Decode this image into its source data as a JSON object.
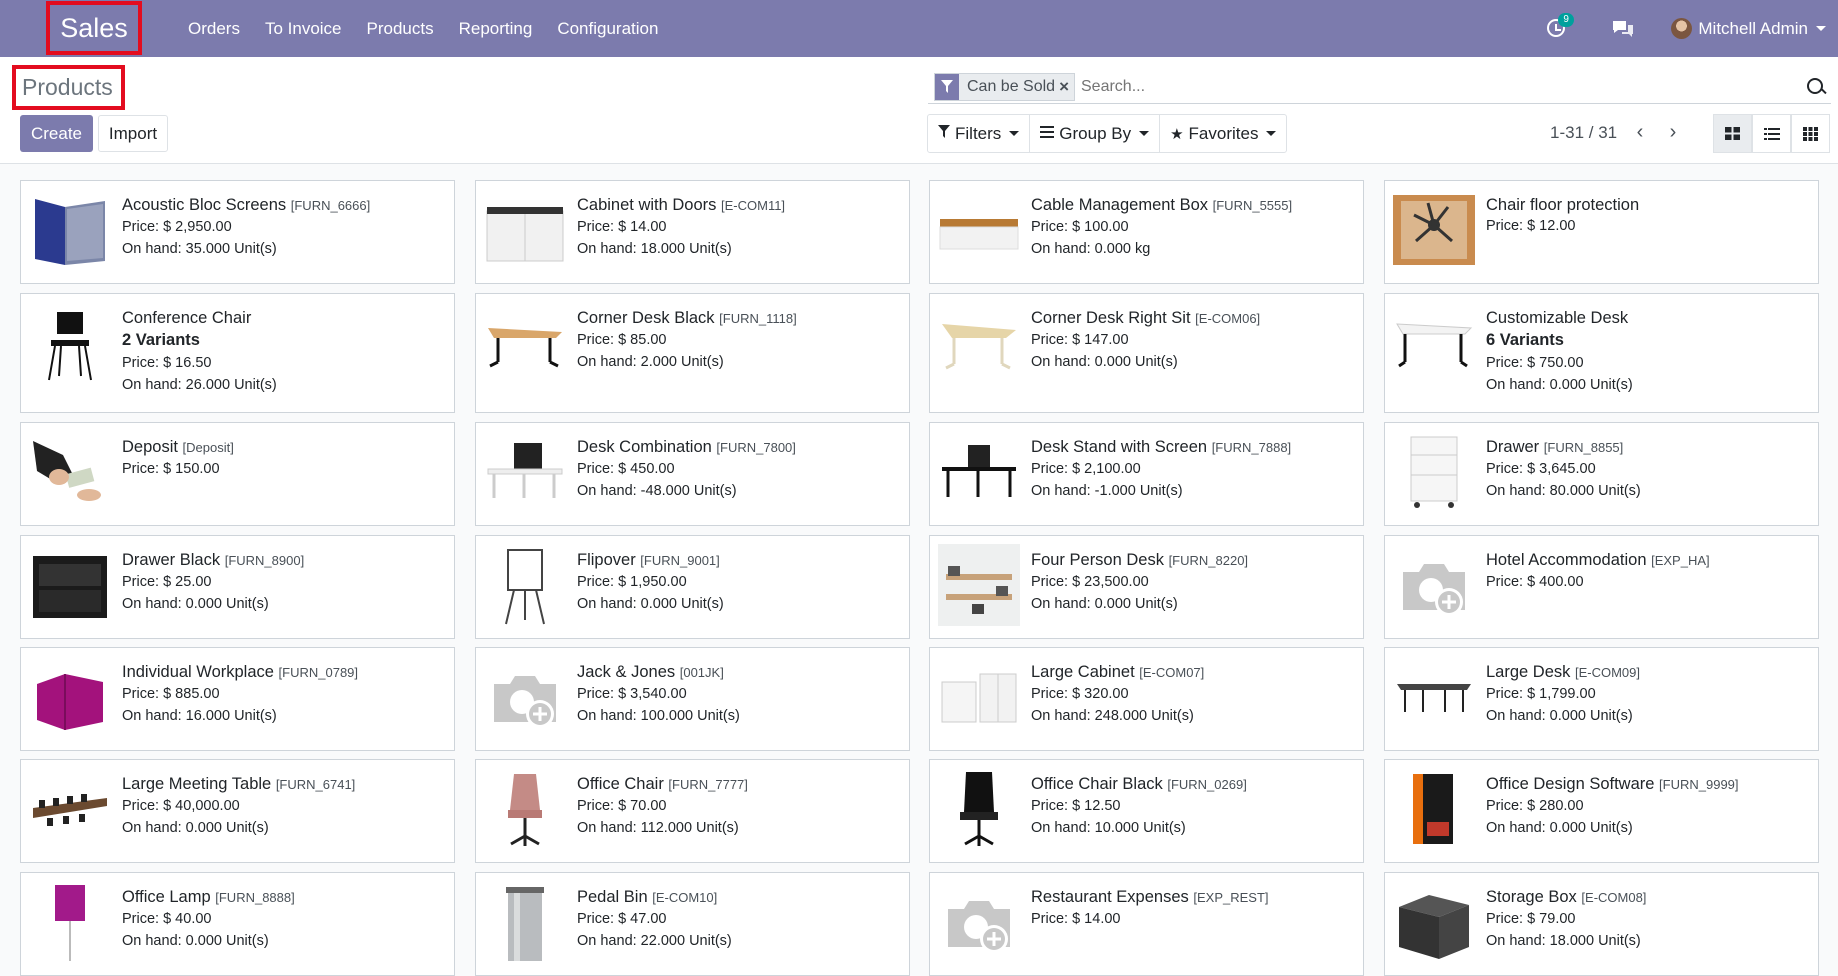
{
  "navbar": {
    "app_name": "Sales",
    "menu": [
      "Orders",
      "To Invoice",
      "Products",
      "Reporting",
      "Configuration"
    ],
    "activity_count": "9",
    "user": "Mitchell Admin"
  },
  "control": {
    "title": "Products",
    "create_label": "Create",
    "import_label": "Import",
    "facet": "Can be Sold",
    "search_placeholder": "Search...",
    "filters_label": "Filters",
    "groupby_label": "Group By",
    "favorites_label": "Favorites",
    "pager": "1-31 / 31"
  },
  "products": [
    {
      "name": "Acoustic Bloc Screens",
      "code": "[FURN_6666]",
      "price": "Price: $ 2,950.00",
      "onhand": "On hand: 35.000 Unit(s)",
      "img": "screen"
    },
    {
      "name": "Cabinet with Doors",
      "code": "[E-COM11]",
      "price": "Price: $ 14.00",
      "onhand": "On hand: 18.000 Unit(s)",
      "img": "cabinet"
    },
    {
      "name": "Cable Management Box",
      "code": "[FURN_5555]",
      "price": "Price: $ 100.00",
      "onhand": "On hand: 0.000 kg",
      "img": "cablebox"
    },
    {
      "name": "Chair floor protection",
      "code": "",
      "price": "Price: $ 12.00",
      "onhand": "",
      "img": "floor"
    },
    {
      "name": "Conference Chair",
      "code": "",
      "variants": "2 Variants",
      "price": "Price: $ 16.50",
      "onhand": "On hand: 26.000 Unit(s)",
      "img": "chair"
    },
    {
      "name": "Corner Desk Black",
      "code": "[FURN_1118]",
      "price": "Price: $ 85.00",
      "onhand": "On hand: 2.000 Unit(s)",
      "img": "desk"
    },
    {
      "name": "Corner Desk Right Sit",
      "code": "[E-COM06]",
      "price": "Price: $ 147.00",
      "onhand": "On hand: 0.000 Unit(s)",
      "img": "desklight"
    },
    {
      "name": "Customizable Desk",
      "code": "",
      "variants": "6 Variants",
      "price": "Price: $ 750.00",
      "onhand": "On hand: 0.000 Unit(s)",
      "img": "deskwhite"
    },
    {
      "name": "Deposit",
      "code": "[Deposit]",
      "price": "Price: $ 150.00",
      "onhand": "",
      "img": "deposit"
    },
    {
      "name": "Desk Combination",
      "code": "[FURN_7800]",
      "price": "Price: $ 450.00",
      "onhand": "On hand: -48.000 Unit(s)",
      "img": "deskcombo"
    },
    {
      "name": "Desk Stand with Screen",
      "code": "[FURN_7888]",
      "price": "Price: $ 2,100.00",
      "onhand": "On hand: -1.000 Unit(s)",
      "img": "deskscreen"
    },
    {
      "name": "Drawer",
      "code": "[FURN_8855]",
      "price": "Price: $ 3,645.00",
      "onhand": "On hand: 80.000 Unit(s)",
      "img": "drawer"
    },
    {
      "name": "Drawer Black",
      "code": "[FURN_8900]",
      "price": "Price: $ 25.00",
      "onhand": "On hand: 0.000 Unit(s)",
      "img": "drawerblack"
    },
    {
      "name": "Flipover",
      "code": "[FURN_9001]",
      "price": "Price: $ 1,950.00",
      "onhand": "On hand: 0.000 Unit(s)",
      "img": "flipover"
    },
    {
      "name": "Four Person Desk",
      "code": "[FURN_8220]",
      "price": "Price: $ 23,500.00",
      "onhand": "On hand: 0.000 Unit(s)",
      "img": "fourdesk"
    },
    {
      "name": "Hotel Accommodation",
      "code": "[EXP_HA]",
      "price": "Price: $ 400.00",
      "onhand": "",
      "img": "placeholder"
    },
    {
      "name": "Individual Workplace",
      "code": "[FURN_0789]",
      "price": "Price: $ 885.00",
      "onhand": "On hand: 16.000 Unit(s)",
      "img": "workplace"
    },
    {
      "name": "Jack & Jones",
      "code": "[001JK]",
      "price": "Price: $ 3,540.00",
      "onhand": "On hand: 100.000 Unit(s)",
      "img": "placeholder"
    },
    {
      "name": "Large Cabinet",
      "code": "[E-COM07]",
      "price": "Price: $ 320.00",
      "onhand": "On hand: 248.000 Unit(s)",
      "img": "largecabinet"
    },
    {
      "name": "Large Desk",
      "code": "[E-COM09]",
      "price": "Price: $ 1,799.00",
      "onhand": "On hand: 0.000 Unit(s)",
      "img": "largedesk"
    },
    {
      "name": "Large Meeting Table",
      "code": "[FURN_6741]",
      "price": "Price: $ 40,000.00",
      "onhand": "On hand: 0.000 Unit(s)",
      "img": "meeting"
    },
    {
      "name": "Office Chair",
      "code": "[FURN_7777]",
      "price": "Price: $ 70.00",
      "onhand": "On hand: 112.000 Unit(s)",
      "img": "officechair"
    },
    {
      "name": "Office Chair Black",
      "code": "[FURN_0269]",
      "price": "Price: $ 12.50",
      "onhand": "On hand: 10.000 Unit(s)",
      "img": "chairblack"
    },
    {
      "name": "Office Design Software",
      "code": "[FURN_9999]",
      "price": "Price: $ 280.00",
      "onhand": "On hand: 0.000 Unit(s)",
      "img": "software"
    },
    {
      "name": "Office Lamp",
      "code": "[FURN_8888]",
      "price": "Price: $ 40.00",
      "onhand": "On hand: 0.000 Unit(s)",
      "img": "lamp"
    },
    {
      "name": "Pedal Bin",
      "code": "[E-COM10]",
      "price": "Price: $ 47.00",
      "onhand": "On hand: 22.000 Unit(s)",
      "img": "bin"
    },
    {
      "name": "Restaurant Expenses",
      "code": "[EXP_REST]",
      "price": "Price: $ 14.00",
      "onhand": "",
      "img": "placeholder"
    },
    {
      "name": "Storage Box",
      "code": "[E-COM08]",
      "price": "Price: $ 79.00",
      "onhand": "On hand: 18.000 Unit(s)",
      "img": "storagebox"
    }
  ]
}
